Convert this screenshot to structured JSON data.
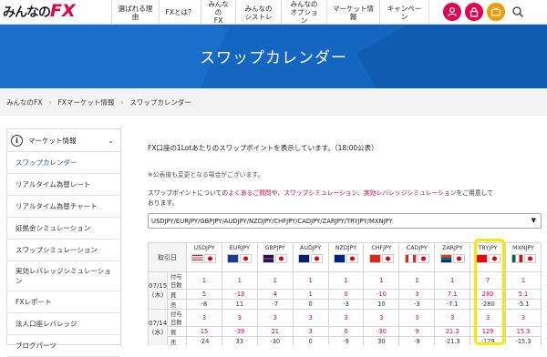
{
  "header": {
    "logo_part1": "みんなの",
    "logo_part2": "FX",
    "nav": [
      "選ばれる理由",
      "FXとは？",
      "みんなの\nFX",
      "みんなの\nシストレ",
      "みんなの\nオプション",
      "マーケット情報",
      "キャンペーン"
    ],
    "icons": [
      "user-icon",
      "lock-icon",
      "tv-icon",
      "search-icon"
    ],
    "accent_color": "#e2004f"
  },
  "hero": {
    "title": "スワップカレンダー",
    "bg_color": "#1466c0"
  },
  "breadcrumb": [
    "みんなのFX",
    "FXマーケット情報",
    "スワップカレンダー"
  ],
  "sidebar": {
    "title": "マーケット情報",
    "items": [
      "スワップカレンダー",
      "リアルタイム為替レート",
      "リアルタイム為替チャート",
      "証拠金シミュレーション",
      "スワップシミュレーション",
      "実効レバレッジシミュレーション",
      "FXレポート",
      "法人口座レバレッジ",
      "ブログパーツ"
    ]
  },
  "main": {
    "intro": "FX口座の1Lotあたりのスワップポイントを表示しています。（18:00公表）",
    "note": "※公表後も変更となる場合がございます。",
    "desc_prefix": "スワップポイントについての",
    "desc_link1": "よくあるご質問",
    "desc_mid1": "や、",
    "desc_link2": "スワップシミュレーション",
    "desc_mid2": "、",
    "desc_link3": "実効レバレッジシミュレーション",
    "desc_suffix": "をご用意して",
    "desc_line2": "おります。",
    "select_value": "USDJPY/EURJPY/GBPJPY/AUDJPY/NZDJPY/CHFJPY/CADJPY/ZARJPY/TRYJPY/MXNJPY"
  },
  "table": {
    "header_label": "取引日",
    "pairs": [
      "USDJPY",
      "EURJPY",
      "GBPJPY",
      "AUDJPY",
      "NZDJPY",
      "CHFJPY",
      "CADJPY",
      "ZARJPY",
      "TRYJPY",
      "MXNJPY"
    ],
    "row_labels": [
      "付与日数",
      "買",
      "売"
    ],
    "groups": [
      {
        "date": "07/15",
        "weekday": "(木)",
        "rows": [
          [
            "1",
            "1",
            "1",
            "1",
            "1",
            "1",
            "1",
            "1",
            "7",
            "1"
          ],
          [
            "5",
            "-13",
            "4",
            "1",
            "0",
            "-10",
            "3",
            "7.1",
            "280",
            "5.1"
          ],
          [
            "-8",
            "11",
            "-7",
            "0",
            "-3",
            "10",
            "-3",
            "-7.1",
            "-280",
            "-5.1"
          ]
        ]
      },
      {
        "date": "07/14",
        "weekday": "(水)",
        "rows": [
          [
            "3",
            "3",
            "3",
            "3",
            "3",
            "3",
            "3",
            "3",
            "3",
            "3"
          ],
          [
            "15",
            "-39",
            "21",
            "3",
            "0",
            "-30",
            "9",
            "21.3",
            "129",
            "15.3"
          ],
          [
            "-24",
            "33",
            "-30",
            "0",
            "-9",
            "30",
            "-9",
            "-21.3",
            "-129",
            "-15.3"
          ]
        ]
      }
    ]
  }
}
